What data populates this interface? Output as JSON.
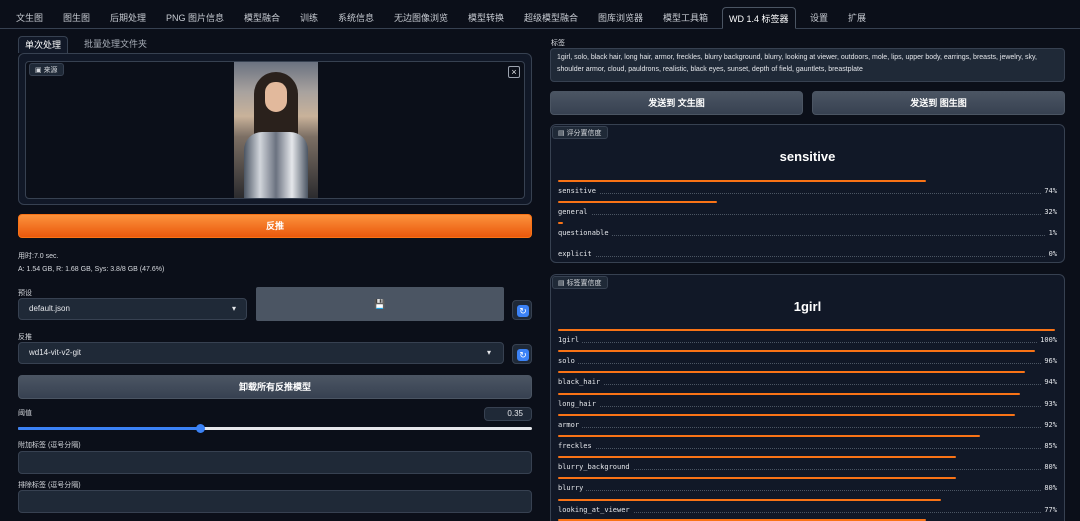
{
  "top_tabs": [
    "文生图",
    "图生图",
    "后期处理",
    "PNG 图片信息",
    "模型融合",
    "训练",
    "系统信息",
    "无边图像浏览",
    "模型转换",
    "超级模型融合",
    "图库浏览器",
    "模型工具箱",
    "WD 1.4 标签器",
    "设置",
    "扩展"
  ],
  "active_top_tab": "WD 1.4 标签器",
  "left": {
    "subtabs": [
      "单次处理",
      "批量处理文件夹"
    ],
    "source_label": "来源",
    "close_glyph": "×",
    "interrogate_button": "反推",
    "time_text": "用时:7.0 sec.",
    "mem_text": "A: 1.54 GB, R: 1.68 GB, Sys: 3.8/8 GB (47.6%)",
    "preset_label": "预设",
    "preset_value": "default.json",
    "save_glyph": "💾",
    "refresh_glyph": "↻",
    "interrogator_label": "反推",
    "interrogator_value": "wd14-vit-v2-git",
    "unload_button": "卸载所有反推模型",
    "threshold_label": "阈值",
    "threshold_value": "0.35",
    "threshold_fraction": 0.35,
    "additional_tags_label": "附加标签 (逗号分隔)",
    "exclude_tags_label": "排除标签 (逗号分隔)"
  },
  "right": {
    "tags_label": "标签",
    "tags_text": "1girl, solo, black hair, long hair, armor, freckles, blurry background, blurry, looking at viewer, outdoors, mole, lips, upper body, earrings, breasts, jewelry, sky, shoulder armor, cloud, pauldrons, realistic, black eyes, sunset, depth of field, gauntlets, breastplate",
    "send_txt2img": "发送到 文生图",
    "send_img2img": "发送到 图生图",
    "rating_label": "评分置信度",
    "rating_top": "sensitive",
    "ratings": [
      {
        "name": "sensitive",
        "pct": "74%",
        "value": 0.74
      },
      {
        "name": "general",
        "pct": "32%",
        "value": 0.32
      },
      {
        "name": "questionable",
        "pct": "1%",
        "value": 0.01
      },
      {
        "name": "explicit",
        "pct": "0%",
        "value": 0.0
      }
    ],
    "tag_conf_label": "标签置信度",
    "tag_top": "1girl",
    "tag_conf": [
      {
        "name": "1girl",
        "pct": "100%",
        "value": 1.0
      },
      {
        "name": "solo",
        "pct": "96%",
        "value": 0.96
      },
      {
        "name": "black_hair",
        "pct": "94%",
        "value": 0.94
      },
      {
        "name": "long_hair",
        "pct": "93%",
        "value": 0.93
      },
      {
        "name": "armor",
        "pct": "92%",
        "value": 0.92
      },
      {
        "name": "freckles",
        "pct": "85%",
        "value": 0.85
      },
      {
        "name": "blurry_background",
        "pct": "80%",
        "value": 0.8
      },
      {
        "name": "blurry",
        "pct": "80%",
        "value": 0.8
      },
      {
        "name": "looking_at_viewer",
        "pct": "77%",
        "value": 0.77
      }
    ],
    "next_row_value": 0.74
  },
  "colors": {
    "accent": "#f97316",
    "background": "#0b0f19",
    "panel": "#111827",
    "slider": "#3b82f6"
  }
}
